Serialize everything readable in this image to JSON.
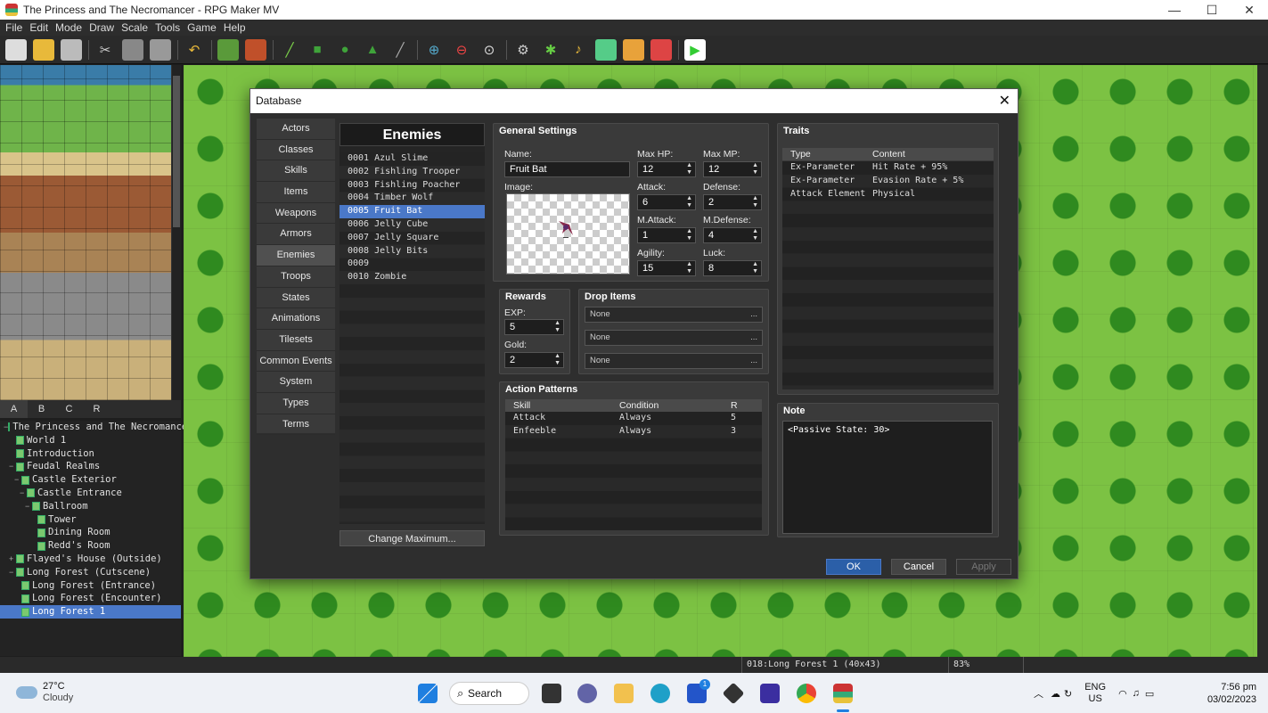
{
  "window": {
    "title": "The Princess and The Necromancer - RPG Maker MV",
    "min": "—",
    "max": "☐",
    "close": "✕"
  },
  "menu": [
    "File",
    "Edit",
    "Mode",
    "Draw",
    "Scale",
    "Tools",
    "Game",
    "Help"
  ],
  "palette_tabs": [
    "A",
    "B",
    "C",
    "R"
  ],
  "map_tree": [
    {
      "label": "The Princess and The Necromancer",
      "indent": 0,
      "tw": "−"
    },
    {
      "label": "World 1",
      "indent": 1,
      "tw": ""
    },
    {
      "label": "Introduction",
      "indent": 1,
      "tw": ""
    },
    {
      "label": "Feudal Realms",
      "indent": 1,
      "tw": "−"
    },
    {
      "label": "Castle Exterior",
      "indent": 2,
      "tw": "−"
    },
    {
      "label": "Castle Entrance",
      "indent": 3,
      "tw": "−"
    },
    {
      "label": "Ballroom",
      "indent": 4,
      "tw": "−"
    },
    {
      "label": "Tower",
      "indent": 5,
      "tw": ""
    },
    {
      "label": "Dining Room",
      "indent": 5,
      "tw": ""
    },
    {
      "label": "Redd's Room",
      "indent": 5,
      "tw": ""
    },
    {
      "label": "Flayed's House (Outside)",
      "indent": 1,
      "tw": "+"
    },
    {
      "label": "Long Forest (Cutscene)",
      "indent": 1,
      "tw": "−"
    },
    {
      "label": "Long Forest (Entrance)",
      "indent": 2,
      "tw": ""
    },
    {
      "label": "Long Forest (Encounter)",
      "indent": 2,
      "tw": ""
    },
    {
      "label": "Long Forest 1",
      "indent": 2,
      "tw": "",
      "selected": true
    }
  ],
  "status": {
    "map_info": "018:Long Forest 1 (40x43)",
    "zoom": "83%"
  },
  "database": {
    "title": "Database",
    "close": "✕",
    "categories": [
      "Actors",
      "Classes",
      "Skills",
      "Items",
      "Weapons",
      "Armors",
      "Enemies",
      "Troops",
      "States",
      "Animations",
      "Tilesets",
      "Common Events",
      "System",
      "Types",
      "Terms"
    ],
    "active_category": "Enemies",
    "list_header": "Enemies",
    "enemies": [
      "0001 Azul Slime",
      "0002 Fishling Trooper",
      "0003 Fishling Poacher",
      "0004 Timber Wolf",
      "0005 Fruit Bat",
      "0006 Jelly Cube",
      "0007 Jelly Square",
      "0008 Jelly Bits",
      "0009",
      "0010 Zombie"
    ],
    "selected_enemy": "0005 Fruit Bat",
    "change_max": "Change Maximum...",
    "general": {
      "title": "General Settings",
      "name_label": "Name:",
      "name": "Fruit Bat",
      "image_label": "Image:",
      "max_hp_label": "Max HP:",
      "max_hp": "12",
      "max_mp_label": "Max MP:",
      "max_mp": "12",
      "attack_label": "Attack:",
      "attack": "6",
      "defense_label": "Defense:",
      "defense": "2",
      "mattack_label": "M.Attack:",
      "mattack": "1",
      "mdefense_label": "M.Defense:",
      "mdefense": "4",
      "agility_label": "Agility:",
      "agility": "15",
      "luck_label": "Luck:",
      "luck": "8"
    },
    "rewards": {
      "title": "Rewards",
      "exp_label": "EXP:",
      "exp": "5",
      "gold_label": "Gold:",
      "gold": "2"
    },
    "drops": {
      "title": "Drop Items",
      "items": [
        "None",
        "None",
        "None"
      ],
      "dots": "..."
    },
    "actions": {
      "title": "Action Patterns",
      "headers": [
        "Skill",
        "Condition",
        "R"
      ],
      "rows": [
        [
          "Attack",
          "Always",
          "5"
        ],
        [
          "Enfeeble",
          "Always",
          "3"
        ]
      ]
    },
    "traits": {
      "title": "Traits",
      "headers": [
        "Type",
        "Content"
      ],
      "rows": [
        [
          "Ex-Parameter",
          "Hit Rate + 95%"
        ],
        [
          "Ex-Parameter",
          "Evasion Rate + 5%"
        ],
        [
          "Attack Element",
          "Physical"
        ]
      ]
    },
    "note": {
      "title": "Note",
      "text": "<Passive State: 30>"
    },
    "buttons": {
      "ok": "OK",
      "cancel": "Cancel",
      "apply": "Apply"
    }
  },
  "taskbar": {
    "temp": "27°C",
    "condition": "Cloudy",
    "search": "Search",
    "lang1": "ENG",
    "lang2": "US",
    "time": "7:56 pm",
    "date": "03/02/2023",
    "badge": "1"
  },
  "colors": {
    "accent": "#4a78c8",
    "ok_button": "#2b5fa8",
    "map_grass": "#7cc243"
  }
}
